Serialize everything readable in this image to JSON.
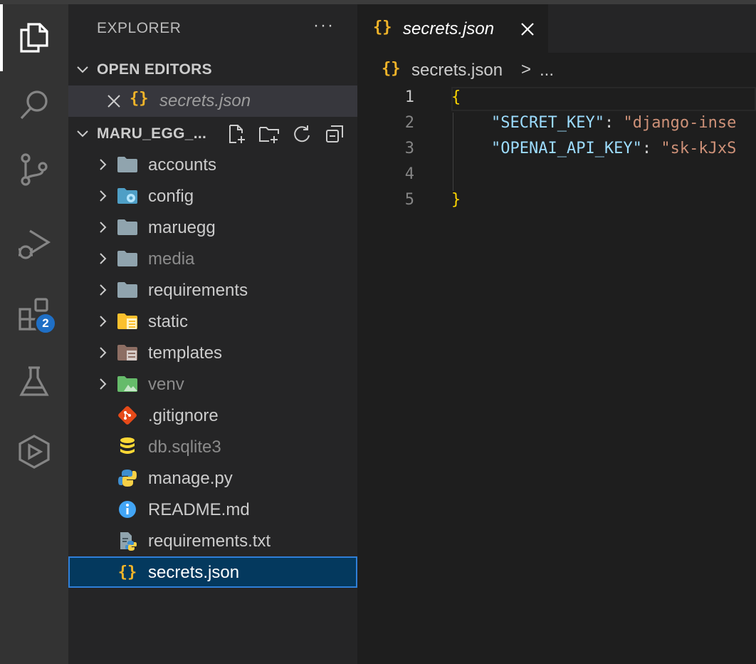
{
  "sidebar": {
    "title": "EXPLORER",
    "more_label": "···",
    "open_editors": {
      "label": "OPEN EDITORS",
      "items": [
        {
          "icon": "{}",
          "name": "secrets.json"
        }
      ]
    },
    "project": {
      "label": "MARU_EGG_...",
      "actions": [
        "new-file-icon",
        "new-folder-icon",
        "refresh-icon",
        "collapse-all-icon"
      ]
    },
    "tree": [
      {
        "name": "accounts",
        "type": "folder",
        "icon": "folder-icon",
        "color": "#90a4ae"
      },
      {
        "name": "config",
        "type": "folder",
        "icon": "folder-config-icon",
        "color": "#42a5f5"
      },
      {
        "name": "maruegg",
        "type": "folder",
        "icon": "folder-icon",
        "color": "#90a4ae"
      },
      {
        "name": "media",
        "type": "folder",
        "icon": "folder-icon",
        "color": "#90a4ae",
        "dim": true
      },
      {
        "name": "requirements",
        "type": "folder",
        "icon": "folder-icon",
        "color": "#90a4ae"
      },
      {
        "name": "static",
        "type": "folder",
        "icon": "folder-static-icon",
        "color": "#fbc02d"
      },
      {
        "name": "templates",
        "type": "folder",
        "icon": "folder-template-icon",
        "color": "#8d6e63"
      },
      {
        "name": "venv",
        "type": "folder",
        "icon": "folder-environment-icon",
        "color": "#66bb6a",
        "dim": true
      },
      {
        "name": ".gitignore",
        "type": "file",
        "icon": "git-icon",
        "color": "#e64a19"
      },
      {
        "name": "db.sqlite3",
        "type": "file",
        "icon": "database-icon",
        "color": "#fdd835",
        "dim": true
      },
      {
        "name": "manage.py",
        "type": "file",
        "icon": "python-icon",
        "color": "#3f8fd0"
      },
      {
        "name": "README.md",
        "type": "file",
        "icon": "info-icon",
        "color": "#42a5f5"
      },
      {
        "name": "requirements.txt",
        "type": "file",
        "icon": "python-requirements-icon",
        "color": "#90a4ae"
      },
      {
        "name": "secrets.json",
        "type": "file",
        "icon": "json-icon",
        "color": "#f0b429",
        "selected": true
      }
    ]
  },
  "activity_bar": {
    "items": [
      "explorer-icon",
      "search-icon",
      "source-control-icon",
      "run-debug-icon",
      "extensions-icon",
      "testing-icon",
      "remote-icon"
    ],
    "extensions_badge": "2"
  },
  "tab": {
    "icon": "{}",
    "name": "secrets.json",
    "close": "×"
  },
  "breadcrumbs": {
    "icon": "{}",
    "file": "secrets.json",
    "separator": ">",
    "more": "..."
  },
  "editor": {
    "line_numbers": [
      "1",
      "2",
      "3",
      "4",
      "5"
    ],
    "lines": {
      "l1_brace": "{",
      "l2_key": "\"SECRET_KEY\"",
      "l2_colon": ": ",
      "l2_value": "\"django-inse",
      "l3_key": "\"OPENAI_API_KEY\"",
      "l3_colon": ": ",
      "l3_value": "\"sk-kJxS",
      "l5_brace": "}"
    }
  }
}
